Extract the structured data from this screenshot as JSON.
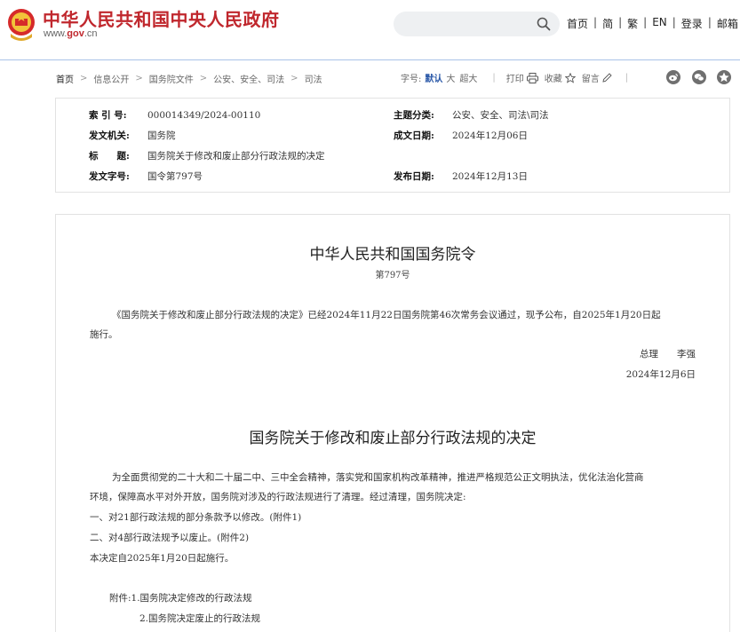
{
  "header": {
    "site_name": "中华人民共和国中央人民政府",
    "site_url_prefix": "www.",
    "site_url_gov": "gov",
    "site_url_suffix": ".cn",
    "search_placeholder": "",
    "nav": [
      "首页",
      "简",
      "繁",
      "EN",
      "登录",
      "邮箱"
    ],
    "brand_color": "#c0272d"
  },
  "breadcrumb": [
    "首页",
    "信息公开",
    "国务院文件",
    "公安、安全、司法",
    "司法"
  ],
  "tools": {
    "font_size_label": "字号:",
    "font_default": "默认",
    "font_large": "大",
    "font_xlarge": "超大",
    "print": "打印",
    "favorite": "收藏",
    "comment": "留言",
    "share_icons": [
      "weibo-icon",
      "wechat-icon",
      "qzone-icon"
    ]
  },
  "meta": {
    "index_label": "索 引 号:",
    "index_value": "000014349/2024-00110",
    "topic_label": "主题分类:",
    "topic_value": "公安、安全、司法\\司法",
    "issuer_label": "发文机关:",
    "issuer_value": "国务院",
    "date_written_label": "成文日期:",
    "date_written_value": "2024年12月06日",
    "title_label": "标　　题:",
    "title_value": "国务院关于修改和废止部分行政法规的决定",
    "doc_no_label": "发文字号:",
    "doc_no_value": "国令第797号",
    "pub_date_label": "发布日期:",
    "pub_date_value": "2024年12月13日"
  },
  "article": {
    "order_title": "中华人民共和国国务院令",
    "order_no": "第797号",
    "order_para_line1": "《国务院关于修改和废止部分行政法规的决定》已经2024年11月22日国务院第46次常务会议通过，现予公布，自2025年1月20日起",
    "order_para_line2": "施行。",
    "signer": "总理　　李强",
    "sign_date": "2024年12月6日",
    "decision_title": "国务院关于修改和废止部分行政法规的决定",
    "decision_para_line1": "为全面贯彻党的二十大和二十届二中、三中全会精神，落实党和国家机构改革精神，推进严格规范公正文明执法，优化法治化营商",
    "decision_para_line2": "环境，保障高水平对外开放，国务院对涉及的行政法规进行了清理。经过清理，国务院决定:",
    "item1": "一、对21部行政法规的部分条款予以修改。(附件1)",
    "item2": "二、对4部行政法规予以废止。(附件2)",
    "effective": "本决定自2025年1月20日起施行。",
    "attachment1": "附件:1.国务院决定修改的行政法规",
    "attachment2": "2.国务院决定废止的行政法规"
  }
}
